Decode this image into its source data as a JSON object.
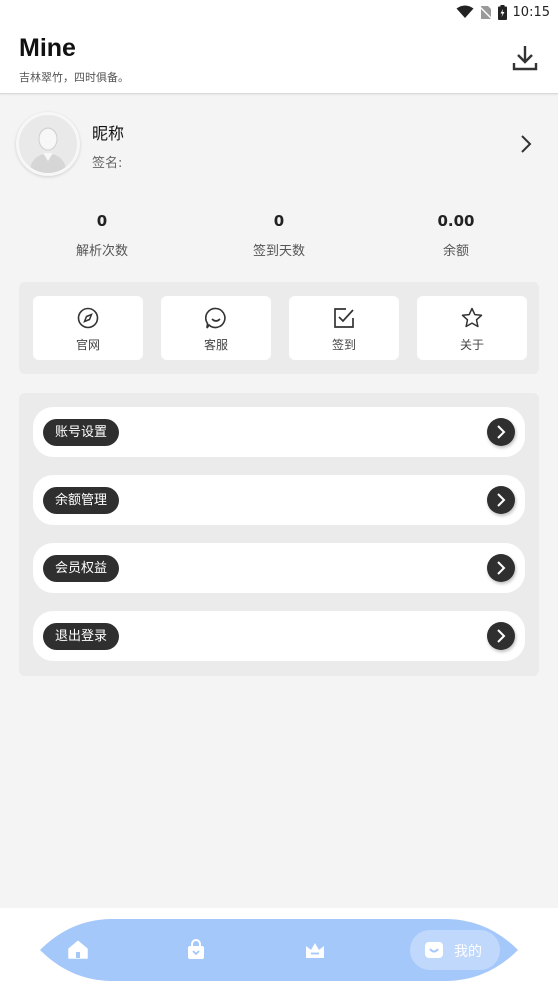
{
  "status_bar": {
    "time": "10:15"
  },
  "header": {
    "title": "Mine",
    "subtitle": "吉林翠竹，四时俱备。"
  },
  "profile": {
    "nickname": "昵称",
    "signature": "签名:"
  },
  "stats": [
    {
      "value": "0",
      "label": "解析次数"
    },
    {
      "value": "0",
      "label": "签到天数"
    },
    {
      "value": "0.00",
      "label": "余额"
    }
  ],
  "shortcuts": [
    {
      "label": "官网",
      "icon": "compass-icon"
    },
    {
      "label": "客服",
      "icon": "smile-chat-icon"
    },
    {
      "label": "签到",
      "icon": "checkbox-icon"
    },
    {
      "label": "关于",
      "icon": "star-icon"
    }
  ],
  "menu": [
    {
      "label": "账号设置"
    },
    {
      "label": "余额管理"
    },
    {
      "label": "会员权益"
    },
    {
      "label": "退出登录"
    }
  ],
  "bottom_nav": {
    "active_label": "我的",
    "icons": [
      "home-icon",
      "bag-icon",
      "crown-icon",
      "profile-icon"
    ],
    "color": "#a5c8fb"
  }
}
